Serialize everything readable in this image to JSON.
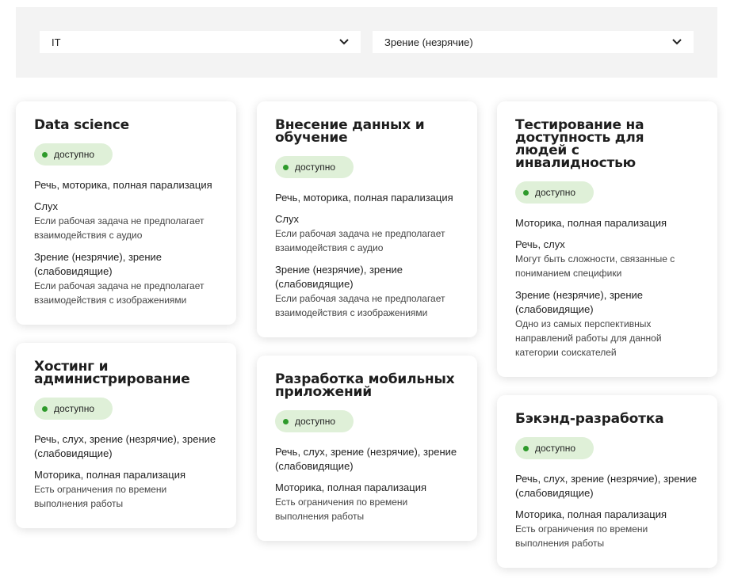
{
  "filters": {
    "category": {
      "value": "IT"
    },
    "disability": {
      "value": "Зрение (незрячие)"
    }
  },
  "icons": {
    "dropdown": "chevron-down-icon",
    "status": "green-dot-icon"
  },
  "colors": {
    "badge_bg": "#dff0d8",
    "badge_dot": "#2e9a2b",
    "filter_bg": "#f3f3f3"
  },
  "cards": [
    {
      "title": "Data science",
      "status": "доступно",
      "fully": "Речь, моторика, полная парализация",
      "groups": [
        {
          "title": "Слух",
          "desc": "Если рабочая задача не предполагает взаимодействия с аудио"
        },
        {
          "title": "Зрение (незрячие), зрение (слабовидящие)",
          "desc": "Если рабочая задача не предполагает взаимодействия с изображениями"
        }
      ]
    },
    {
      "title": "Хостинг и администрирование",
      "status": "доступно",
      "fully": "Речь, слух, зрение (незрячие), зрение (слабовидящие)",
      "groups": [
        {
          "title": "Моторика, полная парализация",
          "desc": "Есть ограничения по времени выполнения работы"
        }
      ]
    },
    {
      "title": "Внесение данных и обучение",
      "status": "доступно",
      "fully": "Речь, моторика, полная парализация",
      "groups": [
        {
          "title": "Слух",
          "desc": "Если рабочая задача не предполагает взаимодействия с аудио"
        },
        {
          "title": "Зрение (незрячие), зрение (слабовидящие)",
          "desc": "Если рабочая задача не предполагает взаимодействия с изображениями"
        }
      ]
    },
    {
      "title": "Разработка мобильных приложений",
      "status": "доступно",
      "fully": "Речь, слух, зрение (незрячие), зрение (слабовидящие)",
      "groups": [
        {
          "title": "Моторика, полная парализация",
          "desc": "Есть ограничения по времени выполнения работы"
        }
      ]
    },
    {
      "title": "Тестирование на доступность для людей с инвалидностью",
      "status": "доступно",
      "fully": "Моторика, полная парализация",
      "groups": [
        {
          "title": "Речь, слух",
          "desc": "Могут быть сложности, связанные с пониманием специфики"
        },
        {
          "title": "Зрение (незрячие), зрение (слабовидящие)",
          "desc": "Одно из самых перспективных направлений работы для данной категории соискателей"
        }
      ]
    },
    {
      "title": "Бэкэнд-разработка",
      "status": "доступно",
      "fully": "Речь, слух, зрение (незрячие), зрение (слабовидящие)",
      "groups": [
        {
          "title": "Моторика, полная парализация",
          "desc": "Есть ограничения по времени выполнения работы"
        }
      ]
    }
  ]
}
